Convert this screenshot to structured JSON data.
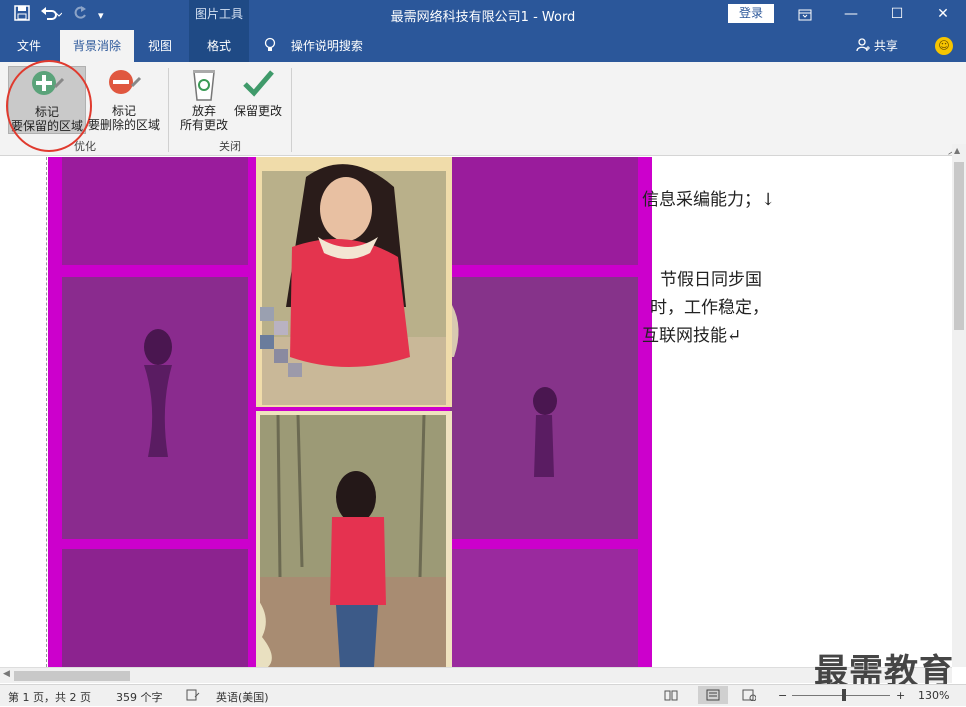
{
  "window": {
    "title": "最需网络科技有限公司1  -  Word",
    "picture_tools_header": "图片工具",
    "login_label": "登录"
  },
  "tabs": {
    "file": "文件",
    "remove_bg": "背景消除",
    "view": "视图",
    "format": "格式",
    "tell_me": "操作说明搜索",
    "share": "共享"
  },
  "ribbon": {
    "keep": {
      "line1": "标记",
      "line2": "要保留的区域"
    },
    "remove": {
      "line1": "标记",
      "line2": "要删除的区域"
    },
    "refine_group": "优化",
    "discard": {
      "line1": "放弃",
      "line2": "所有更改"
    },
    "keep_changes": "保留更改",
    "close_group": "关闭"
  },
  "document": {
    "line1": "信息采编能力；↓",
    "line2": "节假日同步国",
    "line3": "时，工作稳定，",
    "line4": "互联网技能↵"
  },
  "status": {
    "page": "第 1 页，共 2 页",
    "words": "359 个字",
    "language": "英语(美国)",
    "zoom": "130%"
  },
  "watermark": "最需教育",
  "colors": {
    "title_bar": "#2b579a",
    "removal_overlay": "#cc00cc",
    "annotation_circle": "#e03a2e"
  }
}
